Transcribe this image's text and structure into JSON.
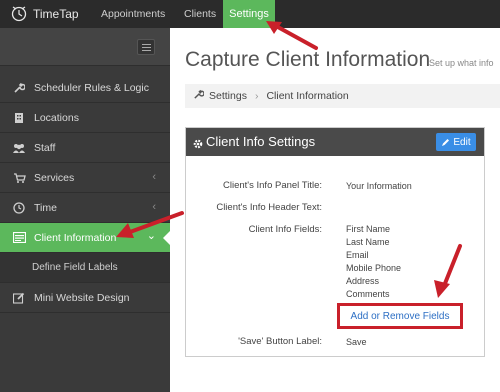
{
  "app": {
    "logo_text": "TimeTap",
    "nav": {
      "appointments": "Appointments",
      "clients": "Clients",
      "settings": "Settings"
    }
  },
  "sidebar": {
    "items": [
      {
        "label": "Scheduler Rules & Logic",
        "icon": "wrench-icon"
      },
      {
        "label": "Locations",
        "icon": "building-icon"
      },
      {
        "label": "Staff",
        "icon": "users-icon"
      },
      {
        "label": "Services",
        "icon": "cart-icon",
        "chevron": "‹"
      },
      {
        "label": "Time",
        "icon": "clock-icon",
        "chevron": "‹"
      },
      {
        "label": "Client Information",
        "icon": "id-card-icon",
        "chevron": "⌄",
        "active": true
      },
      {
        "label": "Define Field Labels",
        "sub": true
      },
      {
        "label": "Mini Website Design",
        "icon": "edit-icon"
      }
    ]
  },
  "main": {
    "title": "Capture Client Information",
    "subtitle": "Set up what info",
    "breadcrumb": [
      "Settings",
      "Client Information"
    ]
  },
  "panel": {
    "title": "Client Info Settings",
    "edit_label": "Edit",
    "rows": {
      "panel_title_label": "Client's Info Panel Title:",
      "panel_title_value": "Your Information",
      "header_text_label": "Client's Info Header Text:",
      "fields_label": "Client Info Fields:",
      "fields": [
        "First Name",
        "Last Name",
        "Email",
        "Mobile Phone",
        "Address",
        "Comments"
      ],
      "add_remove_label": "Add or Remove Fields",
      "save_label_label": "'Save' Button Label:",
      "save_label_value": "Save"
    }
  },
  "colors": {
    "accent_green": "#5cb85c",
    "edit_blue": "#3a8ee6",
    "highlight_red": "#c9202a",
    "link_blue": "#2d6fc4"
  }
}
